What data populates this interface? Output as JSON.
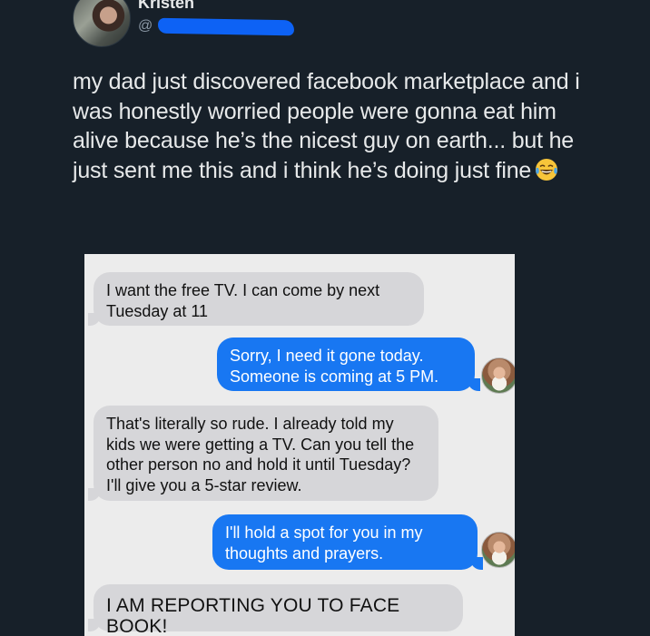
{
  "tweet": {
    "display_name": "Kristen",
    "handle_prefix": "@",
    "text": "my dad just discovered facebook marketplace and i was honestly worried people were gonna eat him alive because he’s the nicest guy on earth... but he just sent me this and i think he’s doing just fine",
    "emoji": "face-with-tears-of-joy"
  },
  "conversation": {
    "messages": [
      {
        "sender": "buyer",
        "text": "I want the free TV. I can come by next Tuesday at 11"
      },
      {
        "sender": "dad",
        "text": "Sorry, I need it gone today. Someone is coming at 5 PM."
      },
      {
        "sender": "buyer",
        "text": "That's literally so rude. I already told my kids we were getting a TV. Can you tell the other person no and hold it until Tuesday? I'll give you a 5-star review."
      },
      {
        "sender": "dad",
        "text": "I'll hold a spot for you in my thoughts and prayers."
      },
      {
        "sender": "buyer",
        "text": "I AM REPORTING YOU TO FACE BOOK!"
      }
    ]
  },
  "colors": {
    "background": "#172029",
    "redaction": "#0d62f5",
    "outgoing_bubble": "#1877f2",
    "incoming_bubble": "#d6d6d9"
  }
}
